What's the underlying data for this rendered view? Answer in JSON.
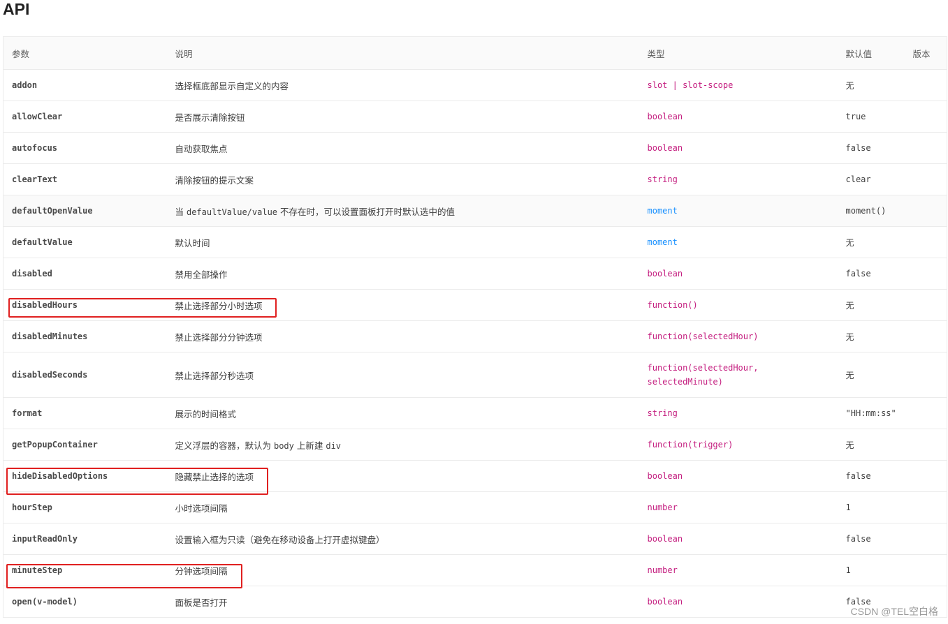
{
  "title": "API",
  "headers": {
    "param": "参数",
    "desc": "说明",
    "type": "类型",
    "default": "默认值",
    "version": "版本"
  },
  "rows": [
    {
      "name": "addon",
      "desc": "选择框底部显示自定义的内容",
      "type": "slot | slot-scope",
      "default": "无"
    },
    {
      "name": "allowClear",
      "desc": "是否展示清除按钮",
      "type": "boolean",
      "default": "true"
    },
    {
      "name": "autofocus",
      "desc": "自动获取焦点",
      "type": "boolean",
      "default": "false"
    },
    {
      "name": "clearText",
      "desc": "清除按钮的提示文案",
      "type": "string",
      "default": "clear"
    },
    {
      "name": "defaultOpenValue",
      "desc_pre": "当 ",
      "desc_code": "defaultValue/value",
      "desc_post": " 不存在时，可以设置面板打开时默认选中的值",
      "type": "moment",
      "default": "moment()"
    },
    {
      "name": "defaultValue",
      "desc": "默认时间",
      "type": "moment",
      "default": "无"
    },
    {
      "name": "disabled",
      "desc": "禁用全部操作",
      "type": "boolean",
      "default": "false"
    },
    {
      "name": "disabledHours",
      "desc": "禁止选择部分小时选项",
      "type": "function()",
      "default": "无"
    },
    {
      "name": "disabledMinutes",
      "desc": "禁止选择部分分钟选项",
      "type": "function(selectedHour)",
      "default": "无"
    },
    {
      "name": "disabledSeconds",
      "desc": "禁止选择部分秒选项",
      "type_line1": "function(selectedHour,",
      "type_line2": "selectedMinute)",
      "default": "无"
    },
    {
      "name": "format",
      "desc": "展示的时间格式",
      "type": "string",
      "default": "\"HH:mm:ss\""
    },
    {
      "name": "getPopupContainer",
      "desc_pre": "定义浮层的容器，默认为 ",
      "desc_code": "body",
      "desc_mid": " 上新建 ",
      "desc_code2": "div",
      "type": "function(trigger)",
      "default": "无"
    },
    {
      "name": "hideDisabledOptions",
      "desc": "隐藏禁止选择的选项",
      "type": "boolean",
      "default": "false"
    },
    {
      "name": "hourStep",
      "desc": "小时选项间隔",
      "type": "number",
      "default": "1"
    },
    {
      "name": "inputReadOnly",
      "desc": "设置输入框为只读（避免在移动设备上打开虚拟键盘）",
      "type": "boolean",
      "default": "false"
    },
    {
      "name": "minuteStep",
      "desc": "分钟选项间隔",
      "type": "number",
      "default": "1"
    },
    {
      "name": "open(v-model)",
      "desc": "面板是否打开",
      "type": "boolean",
      "default": "false"
    }
  ],
  "watermark": "CSDN @TEL空白格",
  "colors": {
    "type": "#c41d7f",
    "moment": "#1890ff",
    "highlight_box": "#e02020"
  }
}
